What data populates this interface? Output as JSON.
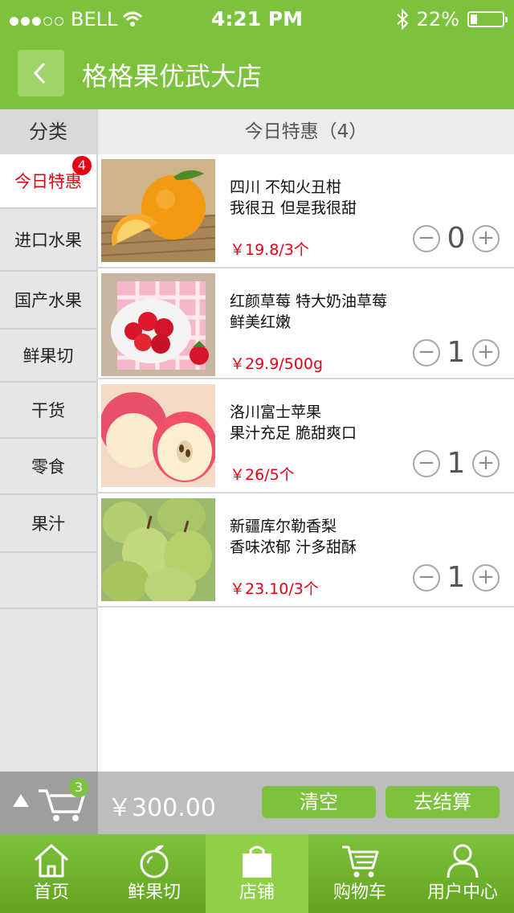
{
  "status": {
    "carrier": "BELL",
    "time": "4:21 PM",
    "battery": "22%",
    "battery_level": 0.22
  },
  "nav": {
    "back_icon": "chevron-left-icon",
    "title": "格格果优武大店"
  },
  "sidebar": {
    "header": "分类",
    "items": [
      {
        "label": "今日特惠",
        "badge": "4",
        "active": true
      },
      {
        "label": "进口水果"
      },
      {
        "label": "国产水果"
      },
      {
        "label": "鲜果切"
      },
      {
        "label": "干货"
      },
      {
        "label": "零食"
      },
      {
        "label": "果汁"
      }
    ]
  },
  "content": {
    "header": "今日特惠（4）"
  },
  "products": [
    {
      "line1": "四川 不知火丑柑",
      "line2": "我很丑 但是我很甜",
      "price": "￥19.8/3个",
      "qty": "0"
    },
    {
      "line1": "红颜草莓 特大奶油草莓",
      "line2": "鲜美红嫩",
      "price": "￥29.9/500g",
      "qty": "1"
    },
    {
      "line1": "洛川富士苹果",
      "line2": "果汁充足 脆甜爽口",
      "price": "￥26/5个",
      "qty": "1"
    },
    {
      "line1": "新疆库尔勒香梨",
      "line2": "香味浓郁 汁多甜酥",
      "price": "￥23.10/3个",
      "qty": "1"
    }
  ],
  "stepper": {
    "minus": "−",
    "plus": "+"
  },
  "cart": {
    "badge": "3",
    "total": "￥300.00",
    "clear_label": "清空",
    "checkout_label": "去结算"
  },
  "tabs": [
    {
      "label": "首页",
      "icon": "home-icon"
    },
    {
      "label": "鲜果切",
      "icon": "fruit-icon"
    },
    {
      "label": "店铺",
      "icon": "shop-bag-icon",
      "active": true
    },
    {
      "label": "购物车",
      "icon": "cart-icon"
    },
    {
      "label": "用户中心",
      "icon": "user-icon"
    }
  ],
  "colors": {
    "brand_green": "#7dc23c",
    "price_red": "#e60012"
  }
}
